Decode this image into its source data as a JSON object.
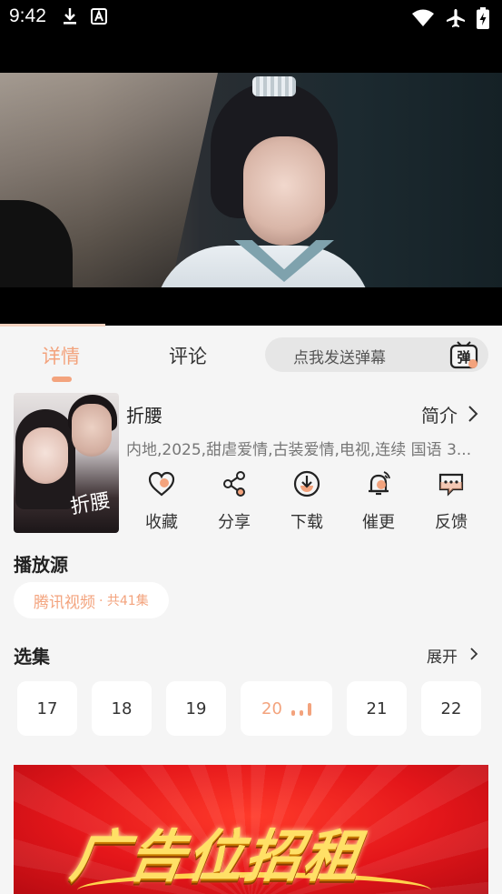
{
  "status_bar": {
    "time": "9:42",
    "left_icons": [
      "download-icon",
      "a-badge-icon"
    ],
    "right_icons": [
      "wifi-icon",
      "airplane-icon",
      "battery-charging-icon"
    ]
  },
  "video": {
    "scene": "video-frame"
  },
  "tabs": {
    "details": "详情",
    "comments": "评论",
    "danmaku_placeholder": "点我发送弹幕",
    "danmaku_icon_text": "弹"
  },
  "show": {
    "poster_title": "折腰",
    "title": "折腰",
    "intro_label": "简介",
    "meta": "内地,2025,甜虐爱情,古装爱情,电视,连续 国语 3..."
  },
  "actions": [
    {
      "label": "收藏",
      "icon": "heart-icon"
    },
    {
      "label": "分享",
      "icon": "share-icon"
    },
    {
      "label": "下载",
      "icon": "download-circle-icon"
    },
    {
      "label": "催更",
      "icon": "bell-icon"
    },
    {
      "label": "反馈",
      "icon": "feedback-icon"
    }
  ],
  "sources": {
    "title": "播放源",
    "selected": {
      "name": "腾讯视频",
      "count": "· 共41集"
    }
  },
  "episodes": {
    "title": "选集",
    "expand_label": "展开",
    "items": [
      "17",
      "18",
      "19",
      "20",
      "21",
      "22"
    ],
    "active": "20"
  },
  "ad": {
    "text": "广告位招租"
  },
  "colors": {
    "accent": "#f3a37d",
    "background": "#f5f5f5",
    "ad_red": "#e4161a",
    "ad_gold": "#ffe066"
  }
}
